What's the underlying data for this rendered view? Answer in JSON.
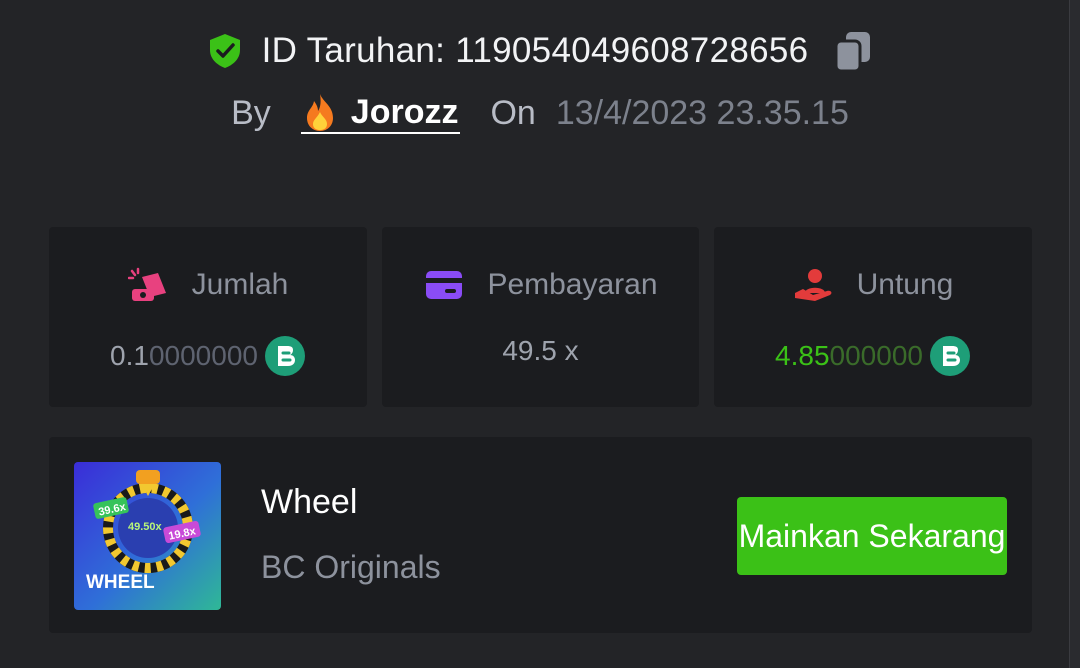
{
  "bet": {
    "id_label": "ID Taruhan: 119054049608728656",
    "by_label": "By",
    "username": "Jorozz",
    "on_label": "On",
    "datetime": "13/4/2023 23.35.15"
  },
  "stats": {
    "amount": {
      "label": "Jumlah",
      "value_main": "0.1",
      "value_dim": "0000000",
      "currency_icon": "bc-coin-icon"
    },
    "payout": {
      "label": "Pembayaran",
      "value": "49.5 x"
    },
    "profit": {
      "label": "Untung",
      "value_main": "4.85",
      "value_dim": "000000",
      "currency_icon": "bc-coin-icon"
    }
  },
  "game": {
    "title": "Wheel",
    "provider": "BC Originals",
    "play_label": "Mainkan Sekarang",
    "thumbnail": {
      "text": "WHEEL",
      "badges": [
        "39.6x",
        "49.50x",
        "19.8x"
      ]
    }
  },
  "colors": {
    "background": "#232427",
    "card": "#1b1c1f",
    "accent_green": "#3bc117",
    "payout_purple": "#8a4cf6",
    "amount_pink": "#e8417f",
    "profit_red": "#e33b3b"
  }
}
